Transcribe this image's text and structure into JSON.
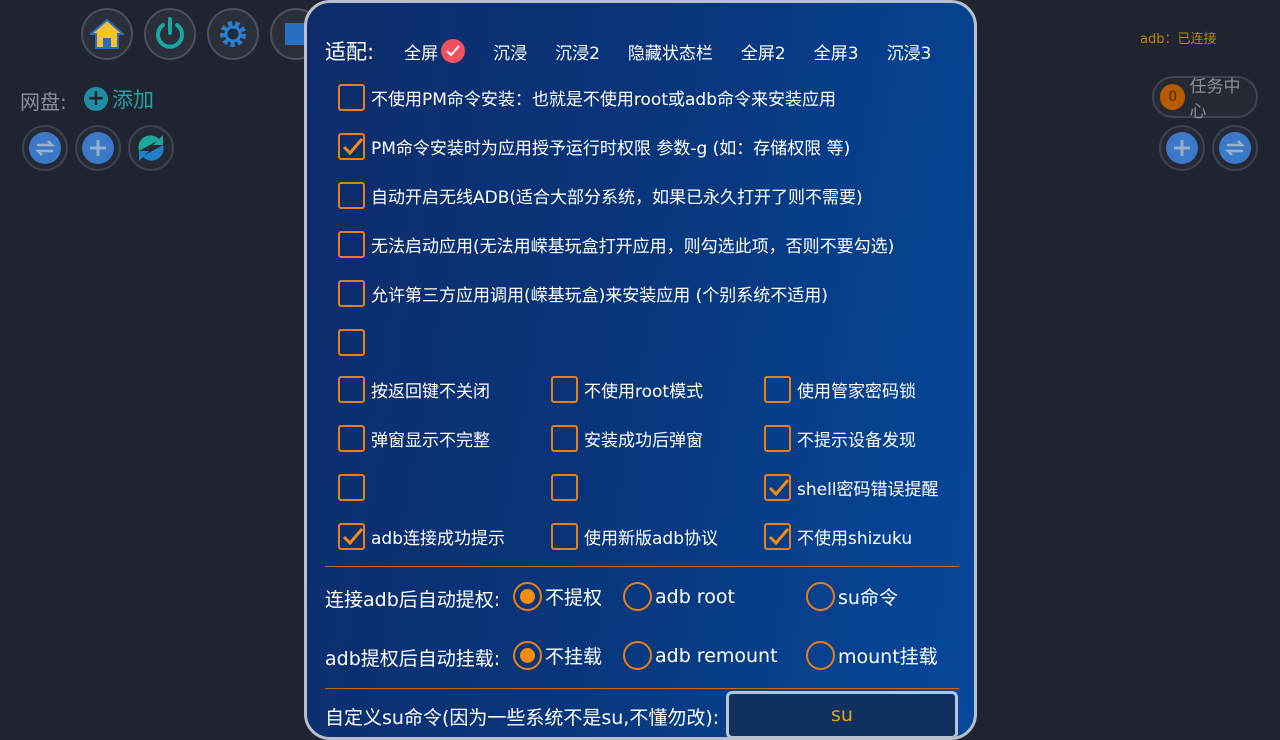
{
  "background": {
    "adb_status": "adb：已连接",
    "netdisk_label": "网盘:",
    "add_label": "添加",
    "task_center": {
      "count": "0",
      "label": "任务中心"
    }
  },
  "dialog": {
    "mode_title": "适配:",
    "modes": [
      "全屏",
      "沉浸",
      "沉浸2",
      "隐藏状态栏",
      "全屏2",
      "全屏3",
      "沉浸3"
    ],
    "selected_mode": "全屏",
    "full_options": [
      {
        "label": "不使用PM命令安装：也就是不使用root或adb命令来安装应用",
        "checked": false
      },
      {
        "label": "PM命令安装时为应用授予运行时权限 参数-g (如：存储权限 等)",
        "checked": true
      },
      {
        "label": "自动开启无线ADB(适合大部分系统，如果已永久打开了则不需要)",
        "checked": false
      },
      {
        "label": "无法启动应用(无法用嵘基玩盒打开应用，则勾选此项，否则不要勾选)",
        "checked": false
      },
      {
        "label": "允许第三方应用调用(嵘基玩盒)来安装应用  (个别系统不适用)",
        "checked": false
      },
      {
        "label": "",
        "checked": false
      }
    ],
    "grid_options": [
      [
        {
          "label": "按返回键不关闭",
          "checked": false
        },
        {
          "label": "不使用root模式",
          "checked": false
        },
        {
          "label": "使用管家密码锁",
          "checked": false
        }
      ],
      [
        {
          "label": "弹窗显示不完整",
          "checked": false
        },
        {
          "label": "安装成功后弹窗",
          "checked": false
        },
        {
          "label": "不提示设备发现",
          "checked": false
        }
      ],
      [
        {
          "label": "",
          "checked": false
        },
        {
          "label": "",
          "checked": false
        },
        {
          "label": "shell密码错误提醒",
          "checked": true
        }
      ],
      [
        {
          "label": "adb连接成功提示",
          "checked": true
        },
        {
          "label": "使用新版adb协议",
          "checked": false
        },
        {
          "label": "不使用shizuku",
          "checked": true
        }
      ]
    ],
    "privilege": {
      "label": "连接adb后自动提权:",
      "options": [
        "不提权",
        "adb root",
        "su命令"
      ],
      "selected": "不提权"
    },
    "mount": {
      "label": "adb提权后自动挂载:",
      "options": [
        "不挂载",
        "adb remount",
        "mount挂载"
      ],
      "selected": "不挂载"
    },
    "su": {
      "label": "自定义su命令(因为一些系统不是su,不懂勿改):",
      "value": "su"
    }
  },
  "colors": {
    "accent": "#e87f1a",
    "badge": "#f05060",
    "su_text": "#e8a21a"
  }
}
